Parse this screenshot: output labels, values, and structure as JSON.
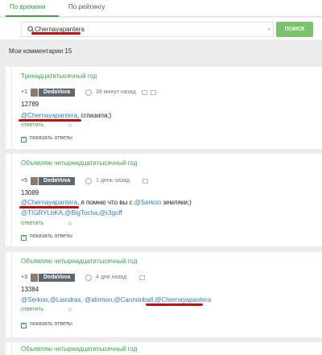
{
  "tabs": {
    "by_time": "По времени",
    "by_rating": "По рейтингу"
  },
  "search": {
    "query": "Chernayapantera",
    "button": "ПОИСК",
    "clear": "×"
  },
  "my_comments_label": "Мои комментарии 15",
  "blocks": [
    {
      "title": "Тринадцатитысячный год",
      "vote": "+1",
      "author": "DedaVova",
      "time": "39 минут назад",
      "number": "12789",
      "text_mention": "@Chernayapantera",
      "text_rest": ", сглазила;)",
      "reply": "ответить",
      "show_replies": "показать ответы"
    },
    {
      "title": "Объявляю четырнадцатитысячный год",
      "vote": "+5",
      "author": "DedaVova",
      "time": "1 день назад",
      "number": "13089",
      "text_mention": "@Chernayapantera",
      "text_mid": ", я помню что вы с ",
      "text_mention2": "@Serkoo",
      "text_rest": " земляки;)",
      "text_line2": "@TIGRYLbKA,@BigTocha,@r3goff",
      "reply": "ответить",
      "show_replies": "показать ответы"
    },
    {
      "title": "Объявляю четырнадцатитысячный год",
      "vote": "+3",
      "author": "DedaVova",
      "time": "4 дня назад",
      "number": "13384",
      "text_line": "@Serkoo,@Liandras, @alirmon,@Cannonball,",
      "text_mention": "@Chernayapantera",
      "reply": "ответить",
      "show_replies": "показать ответы"
    },
    {
      "title": "Объявляю четырнадцатитысячный год"
    }
  ]
}
